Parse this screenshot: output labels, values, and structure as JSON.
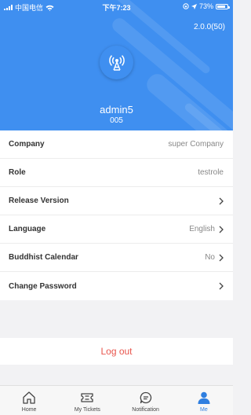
{
  "status_bar": {
    "carrier": "中国电信",
    "time": "下午7:23",
    "battery": "73%"
  },
  "header": {
    "version": "2.0.0(50)",
    "username": "admin5",
    "user_code": "005"
  },
  "settings": [
    {
      "label": "Company",
      "value": "super Company",
      "arrow": false
    },
    {
      "label": "Role",
      "value": "testrole",
      "arrow": false
    },
    {
      "label": "Release Version",
      "value": "",
      "arrow": true
    },
    {
      "label": "Language",
      "value": "English",
      "arrow": true
    },
    {
      "label": "Buddhist Calendar",
      "value": "No",
      "arrow": true
    },
    {
      "label": "Change Password",
      "value": "",
      "arrow": true
    }
  ],
  "logout_label": "Log out",
  "tabs": [
    {
      "label": "Home",
      "icon": "home-icon"
    },
    {
      "label": "My Tickets",
      "icon": "ticket-icon"
    },
    {
      "label": "Notification",
      "icon": "chat-icon"
    },
    {
      "label": "Me",
      "icon": "person-icon",
      "active": true
    }
  ],
  "colors": {
    "primary": "#3f8ff0",
    "logout": "#e8554d",
    "active_tab": "#2f7fe0"
  }
}
